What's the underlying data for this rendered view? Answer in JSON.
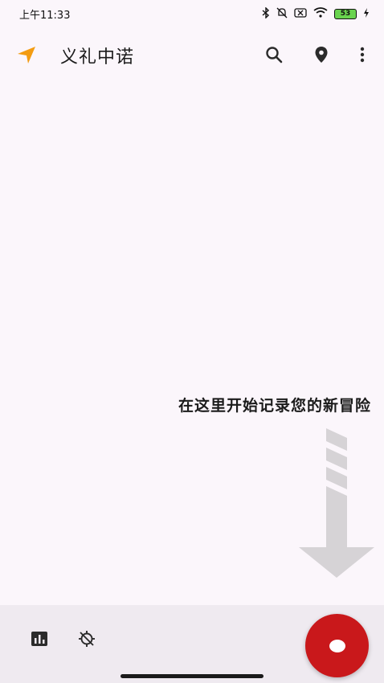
{
  "status_bar": {
    "time": "上午11:33",
    "battery_level": "53",
    "icons": [
      "bluetooth-icon",
      "mute-icon",
      "sim-off-icon",
      "wifi-icon",
      "battery-icon",
      "charging-icon"
    ]
  },
  "appbar": {
    "title": "义礼中诺",
    "icons": [
      "navigation-arrow-icon",
      "search-icon",
      "location-pin-icon",
      "more-vert-icon"
    ]
  },
  "main": {
    "empty_state_text": "在这里开始记录您的新冒险"
  },
  "bottom_bar": {
    "icons": [
      "bar-chart-icon",
      "sync-off-icon",
      "record-icon"
    ]
  },
  "colors": {
    "background": "#fbf6fb",
    "accent": "#f39c12",
    "record": "#c9181b",
    "bottom_bar": "#efeaf0"
  }
}
